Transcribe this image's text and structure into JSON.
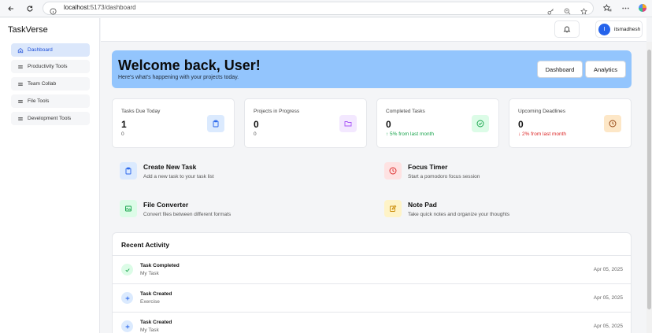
{
  "browser": {
    "url_host": "localhost",
    "url_path": ":5173/dashboard"
  },
  "sidebar": {
    "brand": "TaskVerse",
    "items": [
      {
        "label": "Dashboard",
        "icon": "home-icon",
        "active": true
      },
      {
        "label": "Productivity Tools",
        "icon": "menu-icon",
        "active": false
      },
      {
        "label": "Team Collab",
        "icon": "menu-icon",
        "active": false
      },
      {
        "label": "File Tools",
        "icon": "menu-icon",
        "active": false
      },
      {
        "label": "Development Tools",
        "icon": "menu-icon",
        "active": false
      }
    ]
  },
  "header": {
    "avatar_initial": "I",
    "username": "itsmadhesh"
  },
  "hero": {
    "title": "Welcome back, User!",
    "subtitle": "Here's what's happening with your projects today.",
    "dashboard_button": "Dashboard",
    "analytics_button": "Analytics"
  },
  "stats": [
    {
      "label": "Tasks Due Today",
      "value": "1",
      "sub": "0",
      "icon": "clipboard-icon",
      "color": "#2563eb",
      "bg": "#dbeafe"
    },
    {
      "label": "Projects in Progress",
      "value": "0",
      "sub": "0",
      "icon": "folder-icon",
      "color": "#a855f7",
      "bg": "#f3e8ff"
    },
    {
      "label": "Completed Tasks",
      "value": "0",
      "sub": "↑ 5% from last month",
      "icon": "check-circle-icon",
      "color": "#16a34a",
      "bg": "#dcfce7"
    },
    {
      "label": "Upcoming Deadlines",
      "value": "0",
      "sub": "↓ 2% from last month",
      "icon": "clock-icon",
      "color": "#b45309",
      "bg": "#fde7c7"
    }
  ],
  "actions": [
    {
      "title": "Create New Task",
      "desc": "Add a new task to your task list",
      "icon": "clipboard-icon",
      "color": "#2563eb",
      "bg": "#dbeafe"
    },
    {
      "title": "Focus Timer",
      "desc": "Start a pomodoro focus session",
      "icon": "clock-icon",
      "color": "#dc2626",
      "bg": "#fee2e2"
    },
    {
      "title": "File Converter",
      "desc": "Convert files between different formats",
      "icon": "image-icon",
      "color": "#16a34a",
      "bg": "#dcfce7"
    },
    {
      "title": "Note Pad",
      "desc": "Take quick notes and organize your thoughts",
      "icon": "edit-icon",
      "color": "#ca8a04",
      "bg": "#fef3c7"
    }
  ],
  "recent": {
    "title": "Recent Activity",
    "items": [
      {
        "title": "Task Completed",
        "sub": "My Task",
        "date": "Apr 05, 2025",
        "icon": "check-icon",
        "color": "#16a34a",
        "bg": "#dcfce7"
      },
      {
        "title": "Task Created",
        "sub": "Exercise",
        "date": "Apr 05, 2025",
        "icon": "plus-icon",
        "color": "#2563eb",
        "bg": "#dbeafe"
      },
      {
        "title": "Task Created",
        "sub": "My Task",
        "date": "Apr 05, 2025",
        "icon": "plus-icon",
        "color": "#2563eb",
        "bg": "#dbeafe"
      }
    ]
  }
}
